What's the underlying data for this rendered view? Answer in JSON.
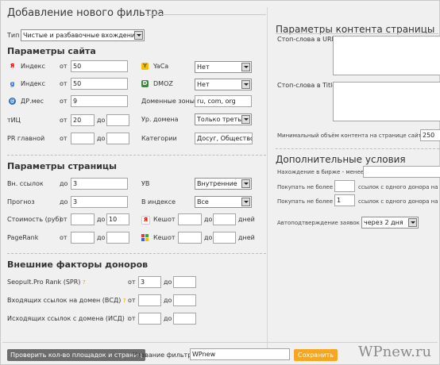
{
  "header": {
    "title": "Добавление нового фильтра"
  },
  "type_row": {
    "label": "Тип",
    "value": "Чистые и разбавочные вхождения"
  },
  "site_params": {
    "title": "Параметры сайта",
    "from": "от",
    "to": "до",
    "yandex_index": {
      "label": "Индекс",
      "value": "50"
    },
    "google_index": {
      "label": "Индекс",
      "value": "50"
    },
    "dr_mes": {
      "label": "ДР.мес",
      "value": "9"
    },
    "tic": {
      "label": "тИЦ",
      "from": "20",
      "to": ""
    },
    "pr": {
      "label": "PR главной",
      "from": "",
      "to": ""
    },
    "yaca": {
      "label": "YaCa",
      "value": "Нет"
    },
    "dmoz": {
      "label": "DMOZ",
      "value": "Нет"
    },
    "zones": {
      "label": "Доменные зоны",
      "value": "ru, com, org"
    },
    "domain_level": {
      "label": "Ур. домена",
      "value": "Только треть"
    },
    "categories": {
      "label": "Категории",
      "value": "Досуг, Общество"
    }
  },
  "page_params": {
    "title": "Параметры страницы",
    "ext_links": {
      "label": "Вн. ссылок",
      "prefix": "до",
      "value": "3"
    },
    "forecast": {
      "label": "Прогноз",
      "prefix": "до",
      "value": "3"
    },
    "cost": {
      "label": "Стоимость (руб)",
      "from": "",
      "to": "10"
    },
    "pagerank": {
      "label": "PageRank",
      "from": "",
      "to": ""
    },
    "uv": {
      "label": "УВ",
      "value": "Внутренние"
    },
    "in_index": {
      "label": "В индексе",
      "value": "Все"
    },
    "cache_y": {
      "label": "Кеш",
      "from": "",
      "to": "",
      "unit": "дней"
    },
    "cache_g": {
      "label": "Кеш",
      "from": "",
      "to": "",
      "unit": "дней"
    }
  },
  "external": {
    "title": "Внешние факторы доноров",
    "spr": {
      "label": "Seopult.Pro Rank (SPR)",
      "from": "3",
      "to": ""
    },
    "vsd": {
      "label": "Входящих ссылок на домен (ВСД)",
      "from": "",
      "to": ""
    },
    "isd": {
      "label": "Исходящих ссылок с домена (ИСД)",
      "from": "",
      "to": ""
    },
    "hint_mark": "?"
  },
  "content_params": {
    "title": "Параметры контента страницы",
    "stop_url": "Стоп-слова в URL",
    "stop_title": "Стоп-слова в Title",
    "min_volume": {
      "label": "Минимальный объём контента на странице сайта",
      "value": "250"
    }
  },
  "additional": {
    "title": "Дополнительные условия",
    "exchange": {
      "label": "Нахождение в бирже - менее",
      "value": ""
    },
    "buy1": {
      "label": "Покупать не более",
      "value": "",
      "suffix": "ссылок с одного донора на с"
    },
    "buy2": {
      "label": "Покупать не более",
      "value": "1",
      "suffix": "ссылок с одного донора на д"
    },
    "auto": {
      "label": "Автоподтверждение заявок",
      "value": "через 2 дня"
    }
  },
  "footer": {
    "check_button": "Проверить кол-во площадок и страниц",
    "filter_name_label": "Название фильтра",
    "filter_name_value": "WPnew",
    "save_button": "Сохранить"
  },
  "watermark": "WPnew.ru",
  "colors": {
    "save_button": "#f5a623",
    "check_button": "#6d6d6d",
    "background": "#f0f0f0"
  }
}
